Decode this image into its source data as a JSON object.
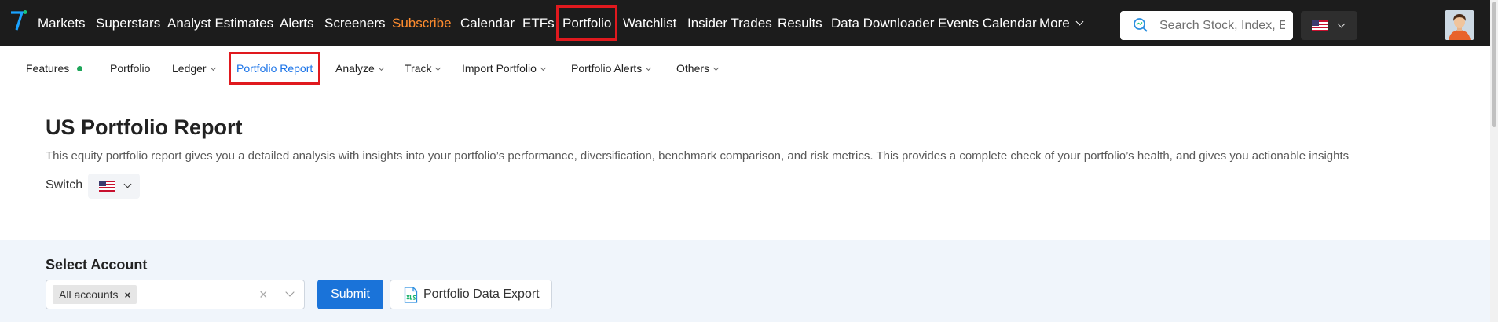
{
  "topnav": {
    "items": [
      {
        "label": "Markets"
      },
      {
        "label": "Superstars"
      },
      {
        "label": "Analyst Estimates"
      },
      {
        "label": "Alerts"
      },
      {
        "label": "Screeners"
      },
      {
        "label": "Subscribe"
      },
      {
        "label": "Calendar"
      },
      {
        "label": "ETFs"
      },
      {
        "label": "Portfolio"
      },
      {
        "label": "Watchlist"
      },
      {
        "label": "Insider Trades"
      },
      {
        "label": "Results"
      },
      {
        "label": "Data Downloader"
      },
      {
        "label": "Events Calendar"
      },
      {
        "label": "More"
      }
    ],
    "search_placeholder": "Search Stock, Index, ETF",
    "highlight_color": "#ff8c2e"
  },
  "subnav": {
    "items": [
      {
        "label": "Features"
      },
      {
        "label": "Portfolio"
      },
      {
        "label": "Ledger"
      },
      {
        "label": "Portfolio Report"
      },
      {
        "label": "Analyze"
      },
      {
        "label": "Track"
      },
      {
        "label": "Import Portfolio"
      },
      {
        "label": "Portfolio Alerts"
      },
      {
        "label": "Others"
      }
    ],
    "active_color": "#1a73e8"
  },
  "page": {
    "title": "US Portfolio Report",
    "description": "This equity portfolio report gives you a detailed analysis with insights into your portfolio’s performance, diversification, benchmark comparison, and risk metrics. This provides a complete check of your portfolio’s health, and gives you actionable insights",
    "switch_label": "Switch"
  },
  "account": {
    "label": "Select Account",
    "selected_tag": "All accounts",
    "tag_remove": "×",
    "clear": "×",
    "submit_label": "Submit",
    "export_label": "Portfolio Data Export"
  }
}
